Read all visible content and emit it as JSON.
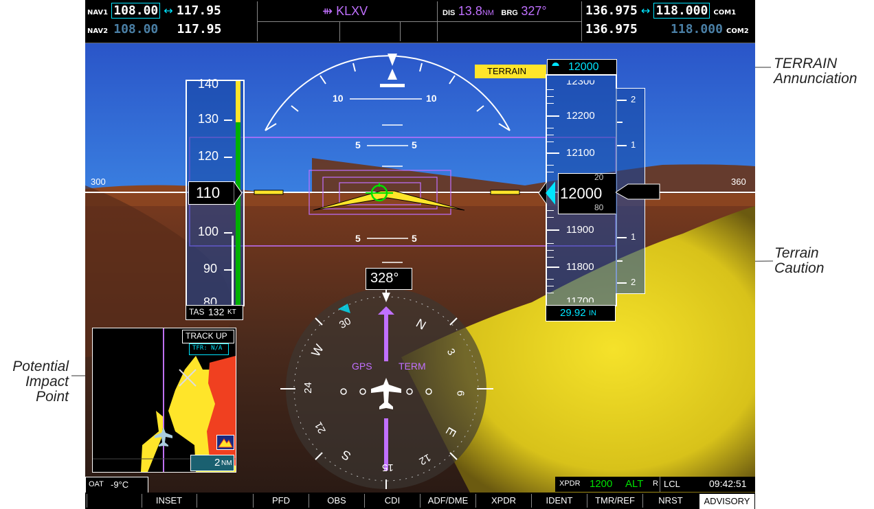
{
  "top": {
    "nav1_label": "NAV1",
    "nav1_active": "108.00",
    "nav1_standby": "117.95",
    "nav2_label": "NAV2",
    "nav2_active": "108.00",
    "nav2_standby": "117.95",
    "swap_arrow": "↔",
    "waypoint": "KLXV",
    "dis_label": "DIS",
    "dis_value": "13.8",
    "dis_unit": "NM",
    "brg_label": "BRG",
    "brg_value": "327°",
    "com1_standby": "136.975",
    "com1_active": "118.000",
    "com1_label": "COM1",
    "com2_standby": "136.975",
    "com2_active": "118.000",
    "com2_label": "COM2"
  },
  "pfd": {
    "heading_300": "300",
    "heading_360": "360",
    "pitch_10": "10",
    "pitch_5": "5",
    "airspeed_ticks": [
      "140",
      "130",
      "120",
      "100",
      "90",
      "80"
    ],
    "airspeed_current": "110",
    "tas_label": "TAS",
    "tas_value": "132",
    "tas_unit": "KT",
    "alt_ticks": [
      "12300",
      "12200",
      "12100",
      "11900",
      "11800",
      "11700"
    ],
    "alt_current": "12000",
    "alt_sub_top": "20",
    "alt_sub_bot": "80",
    "alt_bug": "12000",
    "baro": "29.92",
    "baro_unit": "IN",
    "vsi_ticks": [
      "2",
      "1",
      "1",
      "2"
    ],
    "terrain_annunciation": "TERRAIN",
    "hsi_heading": "328°",
    "hsi_gps": "GPS",
    "hsi_term": "TERM",
    "compass_labels": [
      "N",
      "3",
      "6",
      "E",
      "12",
      "S",
      "21",
      "24",
      "W",
      "30",
      "15"
    ],
    "inset_orientation": "TRACK UP",
    "inset_tfr": "TFR: N/A",
    "inset_range": "2",
    "inset_range_unit": "NM"
  },
  "status": {
    "oat_label": "OAT",
    "oat_value": "-9°C",
    "xpdr_label": "XPDR",
    "xpdr_code": "1200",
    "xpdr_mode": "ALT",
    "reply": "R",
    "time_label": "LCL",
    "time_value": "09:42:51"
  },
  "softkeys": [
    "",
    "INSET",
    "",
    "PFD",
    "OBS",
    "CDI",
    "ADF/DME",
    "XPDR",
    "IDENT",
    "TMR/REF",
    "NRST",
    "ADVISORY"
  ],
  "callouts": {
    "terrain_annunciation": "TERRAIN Annunciation",
    "terrain_caution": "Terrain Caution",
    "impact_point": "Potential Impact Point"
  },
  "colors": {
    "magenta": "#c070ff",
    "cyan": "#00e5ff",
    "yellow": "#ffe52a",
    "green": "#00e000"
  }
}
